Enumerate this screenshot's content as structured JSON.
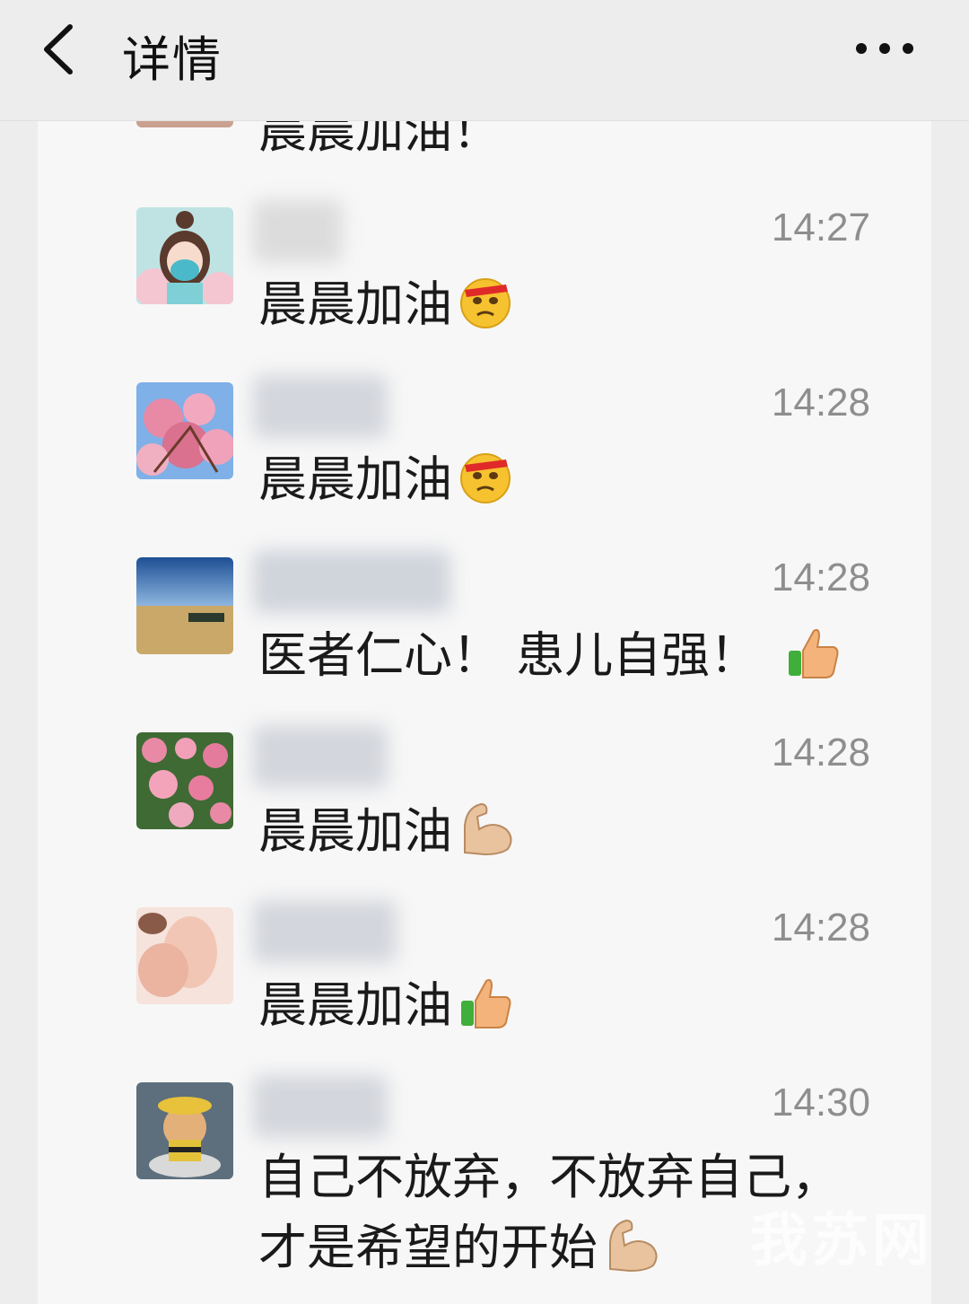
{
  "header": {
    "title": "详情",
    "back_icon": "chevron-left-icon",
    "more_icon": "more-dots-icon"
  },
  "top_partial": {
    "text": "晨晨加油！"
  },
  "entries": [
    {
      "time": "14:27",
      "message": "晨晨加油",
      "emoji": "angry-face-icon"
    },
    {
      "time": "14:28",
      "message": "晨晨加油",
      "emoji": "angry-face-icon"
    },
    {
      "time": "14:28",
      "message": "医者仁心！ 患儿自强！",
      "emoji": "thumbs-up-icon"
    },
    {
      "time": "14:28",
      "message": "晨晨加油",
      "emoji": "flexed-biceps-icon"
    },
    {
      "time": "14:28",
      "message": "晨晨加油",
      "emoji": "thumbs-up-icon"
    },
    {
      "time": "14:30",
      "message_line1": "自己不放弃，不放弃自己，",
      "message_line2": "才是希望的开始",
      "emoji": "flexed-biceps-icon"
    }
  ],
  "watermark": "我苏网"
}
